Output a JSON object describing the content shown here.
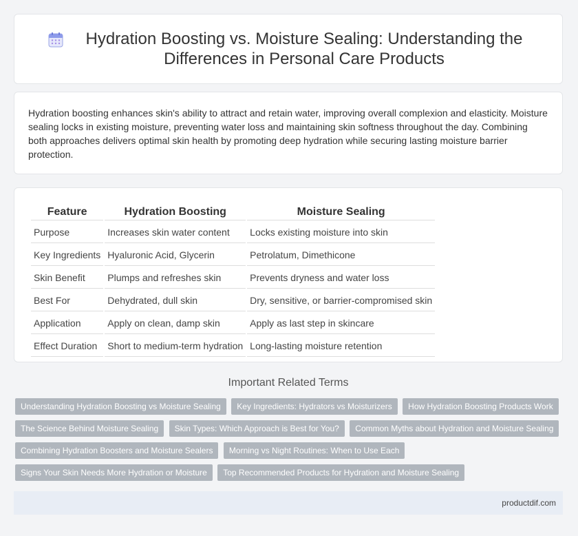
{
  "header": {
    "icon": "calendar-icon",
    "title": "Hydration Boosting vs. Moisture Sealing: Understanding the Differences in Personal Care Products"
  },
  "intro": {
    "text": "Hydration boosting enhances skin's ability to attract and retain water, improving overall complexion and elasticity. Moisture sealing locks in existing moisture, preventing water loss and maintaining skin softness throughout the day. Combining both approaches delivers optimal skin health by promoting deep hydration while securing lasting moisture barrier protection."
  },
  "table": {
    "headers": [
      "Feature",
      "Hydration Boosting",
      "Moisture Sealing"
    ],
    "rows": [
      [
        "Purpose",
        "Increases skin water content",
        "Locks existing moisture into skin"
      ],
      [
        "Key Ingredients",
        "Hyaluronic Acid, Glycerin",
        "Petrolatum, Dimethicone"
      ],
      [
        "Skin Benefit",
        "Plumps and refreshes skin",
        "Prevents dryness and water loss"
      ],
      [
        "Best For",
        "Dehydrated, dull skin",
        "Dry, sensitive, or barrier-compromised skin"
      ],
      [
        "Application",
        "Apply on clean, damp skin",
        "Apply as last step in skincare"
      ],
      [
        "Effect Duration",
        "Short to medium-term hydration",
        "Long-lasting moisture retention"
      ]
    ]
  },
  "related": {
    "heading": "Important Related Terms",
    "tags": [
      "Understanding Hydration Boosting vs Moisture Sealing",
      "Key Ingredients: Hydrators vs Moisturizers",
      "How Hydration Boosting Products Work",
      "The Science Behind Moisture Sealing",
      "Skin Types: Which Approach is Best for You?",
      "Common Myths about Hydration and Moisture Sealing",
      "Combining Hydration Boosters and Moisture Sealers",
      "Morning vs Night Routines: When to Use Each",
      "Signs Your Skin Needs More Hydration or Moisture",
      "Top Recommended Products for Hydration and Moisture Sealing"
    ]
  },
  "footer": {
    "site": "productdif.com"
  }
}
